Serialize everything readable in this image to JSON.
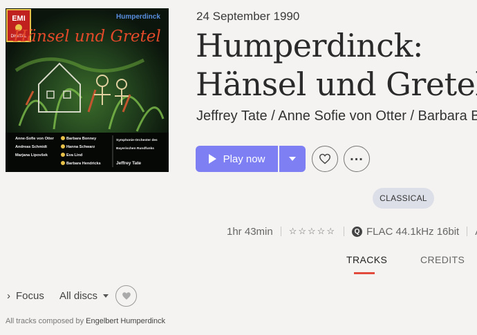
{
  "album": {
    "release_date": "24 September 1990",
    "title_line1": "Humperdinck:",
    "title_line2": "Hänsel und Gretel",
    "artists": "Jeffrey Tate / Anne Sofie von Otter / Barbara B"
  },
  "cover": {
    "label_logo": "EMI",
    "label_sub": "DIGITAL",
    "composer": "Humperdinck",
    "title_art": "Hänsel und Gretel",
    "cast_col1": [
      "Anne-Sofie von Otter",
      "Andreas Schmidt",
      "Marjana Lipovšek"
    ],
    "cast_col2": [
      "Barbara Bonney",
      "Hanna Schwarz",
      "Eva Lind",
      "Barbara Hendricks"
    ],
    "orchestra_line1": "Symphonie-Orchester des",
    "orchestra_line2": "Bayerischen Rundfunks",
    "conductor": "Jeffrey Tate"
  },
  "actions": {
    "play_label": "Play now",
    "play_icon": "play-triangle-icon",
    "dropdown_icon": "caret-down-icon",
    "favorite_icon": "heart-outline-icon",
    "more_icon": "ellipsis-icon"
  },
  "genre": "CLASSICAL",
  "meta": {
    "duration": "1hr 43min",
    "rating_stars": "☆☆☆☆☆",
    "quality_icon": "qobuz-q-icon",
    "quality": "FLAC 44.1kHz 16bit",
    "overflow_text": "Ac"
  },
  "tabs": {
    "tracks": "TRACKS",
    "credits": "CREDITS",
    "active": "TRACKS"
  },
  "filters": {
    "focus_label": "Focus",
    "discs_label": "All discs"
  },
  "composer_note": {
    "prefix": "All tracks composed by",
    "composer": "Engelbert Humperdinck"
  },
  "colors": {
    "accent": "#7d7ff3",
    "tab_underline": "#e24a3b",
    "background": "#f4f3f1",
    "genre_pill": "#dcdfe8"
  }
}
